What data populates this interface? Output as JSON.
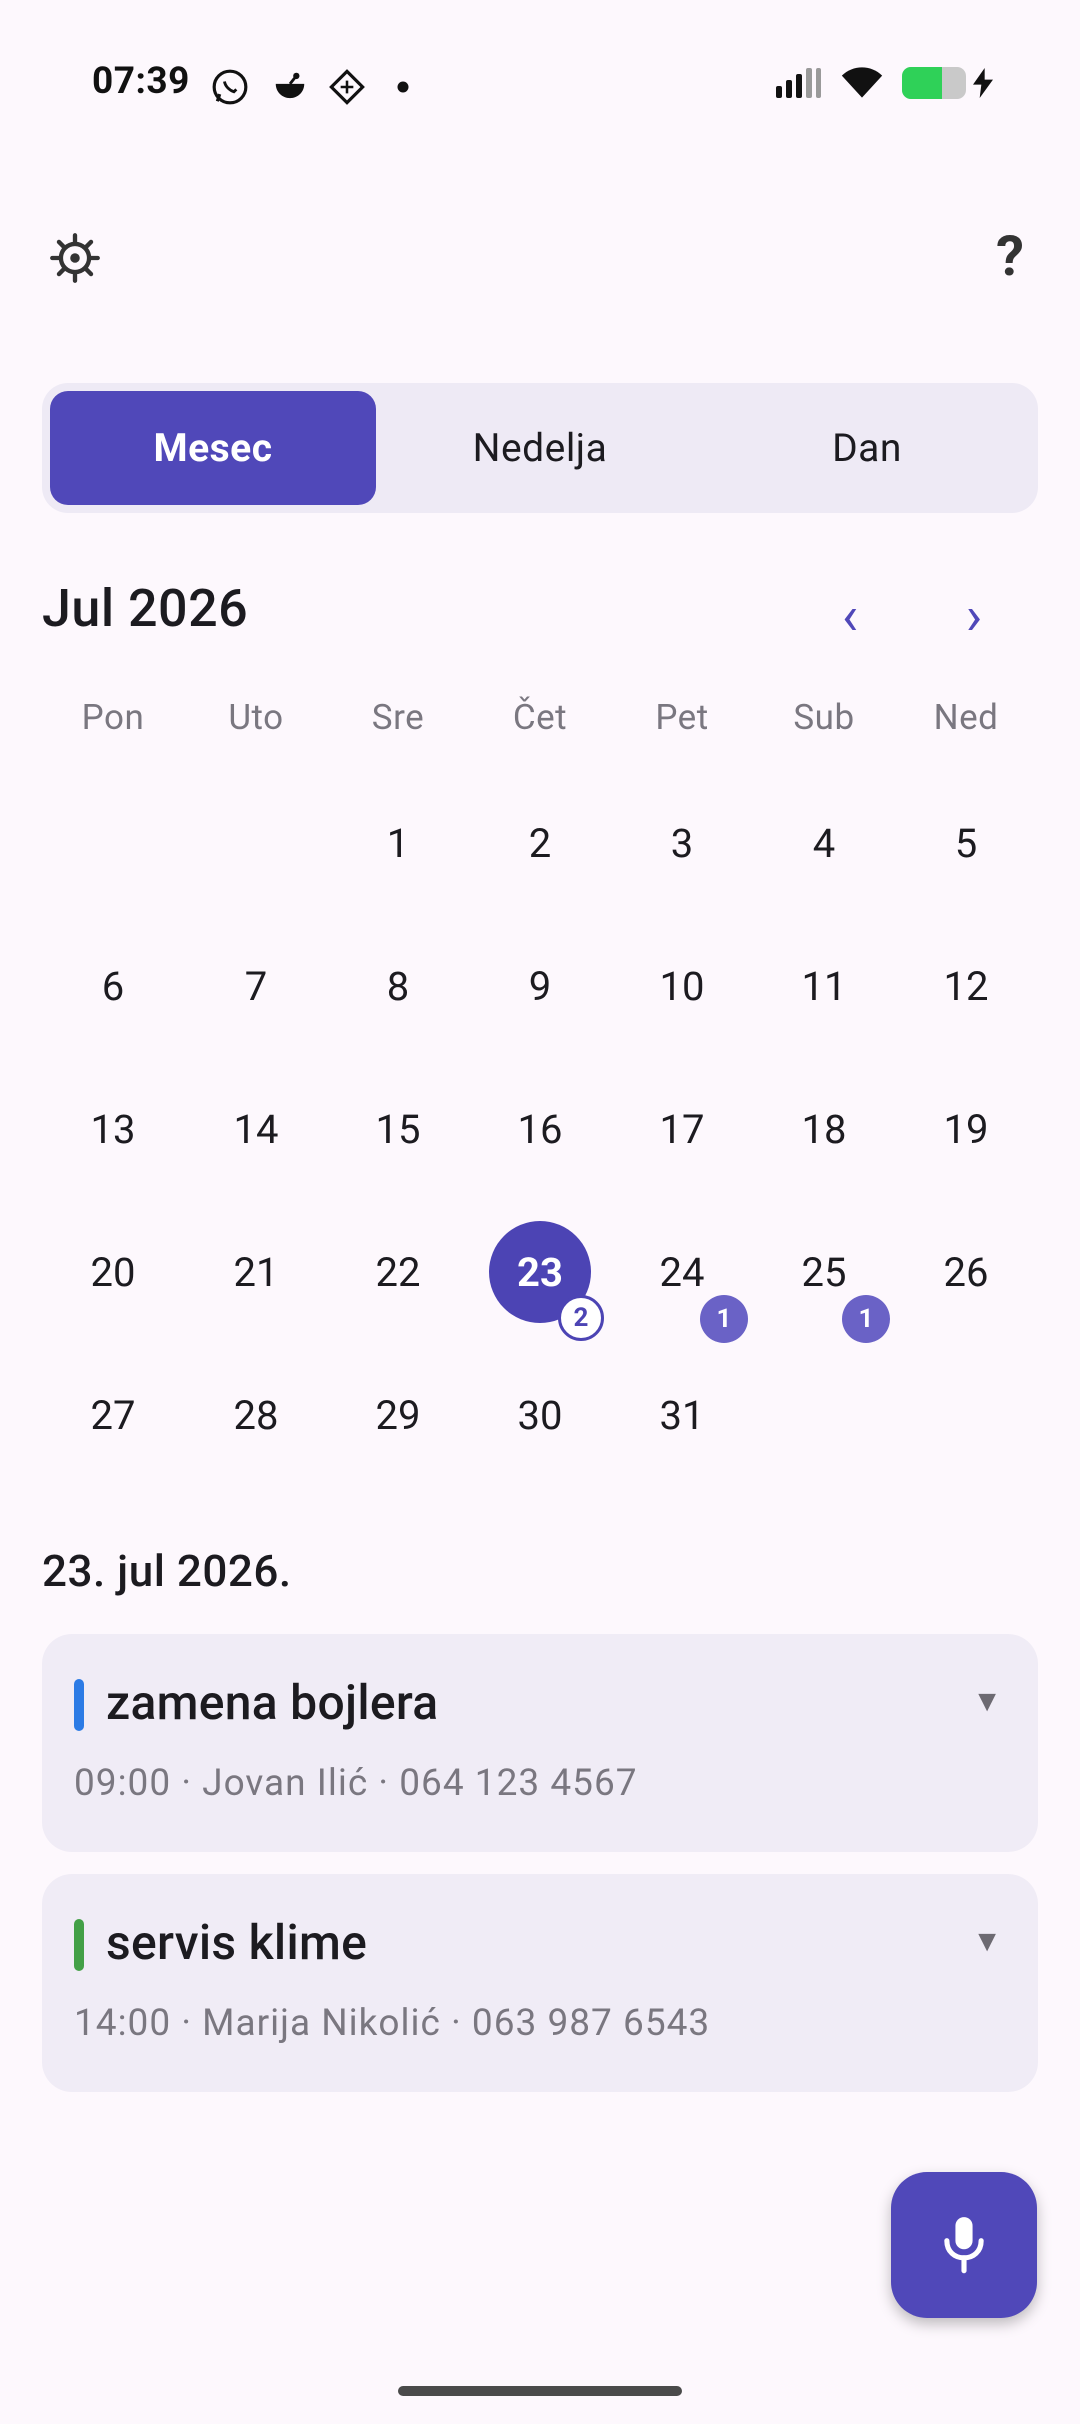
{
  "status_bar": {
    "time": "07:39",
    "left_icons": [
      "whatsapp-icon",
      "app-icon",
      "app-icon-2",
      "dot-icon"
    ],
    "right_icons": [
      "signal-icon",
      "wifi-icon",
      "battery-charging-icon"
    ],
    "battery_level": 0.62
  },
  "toolbar": {
    "settings_icon": "settings-icon",
    "help_label": "?"
  },
  "view_switch": {
    "options": [
      "Mesec",
      "Nedelja",
      "Dan"
    ],
    "selected": "Mesec"
  },
  "calendar": {
    "month_title": "Jul 2026",
    "prev_label": "‹",
    "next_label": "›",
    "weekdays": [
      "Pon",
      "Uto",
      "Sre",
      "Čet",
      "Pet",
      "Sub",
      "Ned"
    ],
    "weeks": [
      [
        "",
        "",
        "1",
        "2",
        "3",
        "4",
        "5"
      ],
      [
        "6",
        "7",
        "8",
        "9",
        "10",
        "11",
        "12"
      ],
      [
        "13",
        "14",
        "15",
        "16",
        "17",
        "18",
        "19"
      ],
      [
        "20",
        "21",
        "22",
        "23",
        "24",
        "25",
        "26"
      ],
      [
        "27",
        "28",
        "29",
        "30",
        "31",
        "",
        ""
      ]
    ],
    "selected_day": "23",
    "event_counts": {
      "23": "2",
      "24": "1",
      "25": "1"
    }
  },
  "selected_date_label": "23. jul 2026.",
  "events": [
    {
      "title": "zamena bojlera",
      "meta": "09:00 · Jovan Ilić · 064 123 4567",
      "color": "#2c7be5",
      "chevron": "▼"
    },
    {
      "title": "servis klime",
      "meta": "14:00 · Marija Nikolić · 063 987 6543",
      "color": "#43a047",
      "chevron": "▼"
    }
  ],
  "colors": {
    "accent": "#5048b9",
    "background": "#fdf8fd",
    "card": "#f0ecf6"
  },
  "fab": {
    "icon": "microphone-icon"
  }
}
